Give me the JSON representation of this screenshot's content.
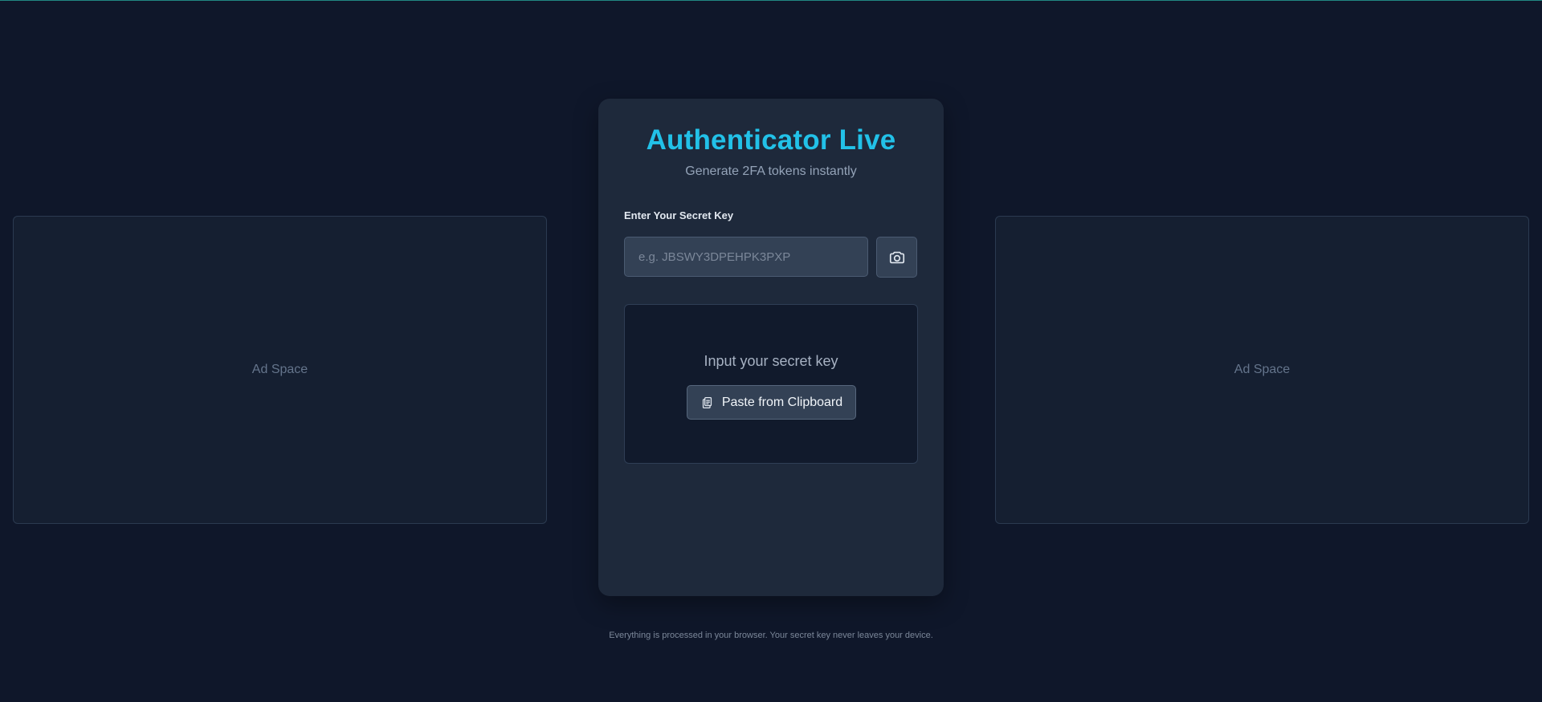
{
  "app": {
    "title": "Authenticator Live",
    "subtitle": "Generate 2FA tokens instantly"
  },
  "secret_key": {
    "label": "Enter Your Secret Key",
    "placeholder": "e.g. JBSWY3DPEHPK3PXP",
    "value": "",
    "camera_icon": "camera-icon"
  },
  "prompt": {
    "message": "Input your secret key",
    "paste_label": "Paste from Clipboard",
    "paste_icon": "clipboard-icon"
  },
  "ads": {
    "left_label": "Ad Space",
    "right_label": "Ad Space"
  },
  "footer": {
    "note": "Everything is processed in your browser. Your secret key never leaves your device."
  },
  "colors": {
    "background": "#0f172a",
    "card": "#1e293b",
    "accent": "#22c1e8",
    "muted_text": "#94a3b8"
  }
}
